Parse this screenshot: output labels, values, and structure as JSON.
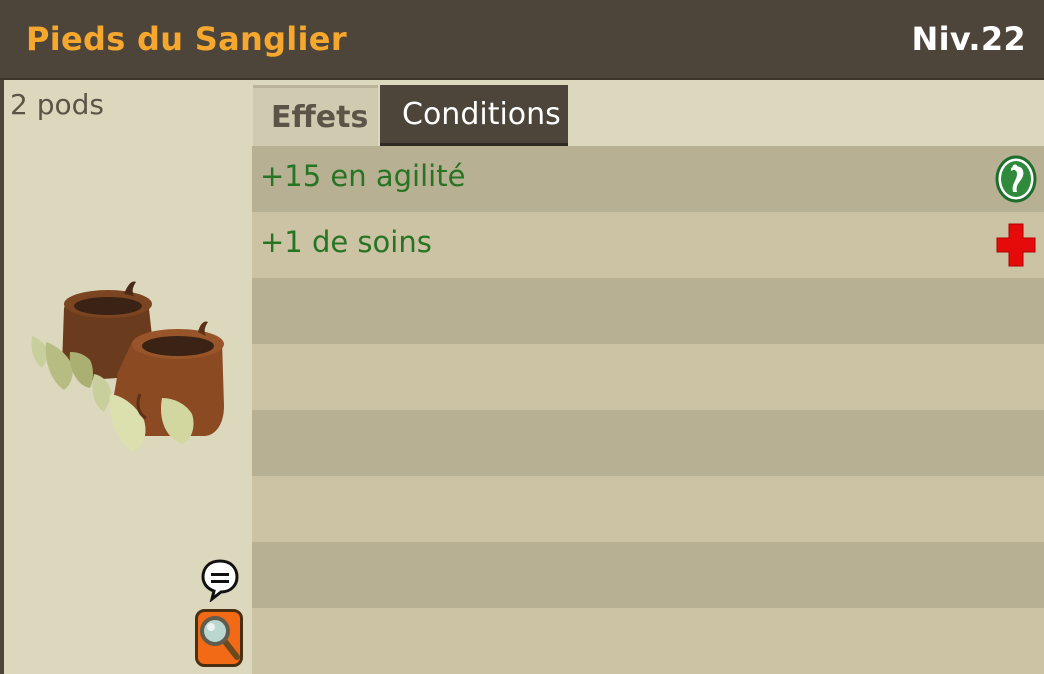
{
  "item": {
    "name": "Pieds du Sanglier",
    "level": "Niv.22",
    "weight": "2 pods"
  },
  "tabs": [
    {
      "label": "Effets",
      "active": true
    },
    {
      "label": "Conditions",
      "active": false
    }
  ],
  "effects": [
    {
      "text": "+15 en agilité",
      "icon": "agility-icon",
      "color": "#277424"
    },
    {
      "text": "+1 de soins",
      "icon": "heal-cross-icon",
      "color": "#277424"
    }
  ],
  "colors": {
    "header_bg": "#4d4539",
    "title": "#f5a72e",
    "effect_text": "#277424",
    "panel_bg": "#dcd8bd"
  }
}
